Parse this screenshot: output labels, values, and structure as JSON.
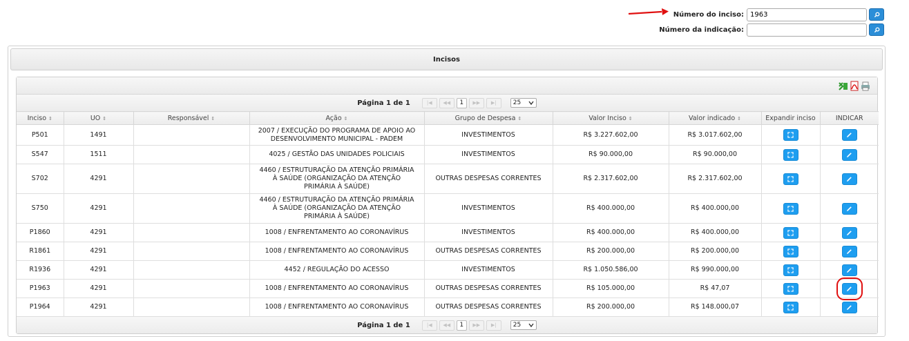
{
  "search": {
    "inciso_label": "Número do inciso:",
    "inciso_value": "1963",
    "indicacao_label": "Número da indicação:",
    "indicacao_value": ""
  },
  "panel": {
    "title": "Incisos"
  },
  "pagination": {
    "info": "Página 1 de 1",
    "current_page": "1",
    "rows_per_page": "25"
  },
  "table": {
    "headers": [
      "Inciso",
      "UO",
      "Responsável",
      "Ação",
      "Grupo de Despesa",
      "Valor Inciso",
      "Valor indicado",
      "Expandir inciso",
      "INDICAR"
    ],
    "rows": [
      {
        "inciso": "P501",
        "uo": "1491",
        "responsavel": "",
        "acao": "2007 / EXECUÇÃO DO PROGRAMA DE APOIO AO DESENVOLVIMENTO MUNICIPAL - PADEM",
        "grupo": "INVESTIMENTOS",
        "valor_inciso": "R$ 3.227.602,00",
        "valor_indicado": "R$ 3.017.602,00"
      },
      {
        "inciso": "S547",
        "uo": "1511",
        "responsavel": "",
        "acao": "4025 / GESTÃO DAS UNIDADES POLICIAIS",
        "grupo": "INVESTIMENTOS",
        "valor_inciso": "R$ 90.000,00",
        "valor_indicado": "R$ 90.000,00"
      },
      {
        "inciso": "S702",
        "uo": "4291",
        "responsavel": "",
        "acao": "4460 / ESTRUTURAÇÃO DA ATENÇÃO PRIMÁRIA À SAÚDE (ORGANIZAÇÃO DA ATENÇÃO PRIMÁRIA À SAÚDE)",
        "grupo": "OUTRAS DESPESAS CORRENTES",
        "valor_inciso": "R$ 2.317.602,00",
        "valor_indicado": "R$ 2.317.602,00"
      },
      {
        "inciso": "S750",
        "uo": "4291",
        "responsavel": "",
        "acao": "4460 / ESTRUTURAÇÃO DA ATENÇÃO PRIMÁRIA À SAÚDE (ORGANIZAÇÃO DA ATENÇÃO PRIMÁRIA À SAÚDE)",
        "grupo": "INVESTIMENTOS",
        "valor_inciso": "R$ 400.000,00",
        "valor_indicado": "R$ 400.000,00"
      },
      {
        "inciso": "P1860",
        "uo": "4291",
        "responsavel": "",
        "acao": "1008 / ENFRENTAMENTO AO CORONAVÍRUS",
        "grupo": "INVESTIMENTOS",
        "valor_inciso": "R$ 400.000,00",
        "valor_indicado": "R$ 400.000,00"
      },
      {
        "inciso": "R1861",
        "uo": "4291",
        "responsavel": "",
        "acao": "1008 / ENFRENTAMENTO AO CORONAVÍRUS",
        "grupo": "OUTRAS DESPESAS CORRENTES",
        "valor_inciso": "R$ 200.000,00",
        "valor_indicado": "R$ 200.000,00"
      },
      {
        "inciso": "R1936",
        "uo": "4291",
        "responsavel": "",
        "acao": "4452 / REGULAÇÃO DO ACESSO",
        "grupo": "INVESTIMENTOS",
        "valor_inciso": "R$ 1.050.586,00",
        "valor_indicado": "R$ 990.000,00"
      },
      {
        "inciso": "P1963",
        "uo": "4291",
        "responsavel": "",
        "acao": "1008 / ENFRENTAMENTO AO CORONAVÍRUS",
        "grupo": "OUTRAS DESPESAS CORRENTES",
        "valor_inciso": "R$ 105.000,00",
        "valor_indicado": "R$ 47,07"
      },
      {
        "inciso": "P1964",
        "uo": "4291",
        "responsavel": "",
        "acao": "1008 / ENFRENTAMENTO AO CORONAVÍRUS",
        "grupo": "OUTRAS DESPESAS CORRENTES",
        "valor_inciso": "R$ 200.000,00",
        "valor_indicado": "R$ 148.000,07"
      }
    ]
  },
  "icons": {
    "search": "search-icon",
    "expand": "expand-icon",
    "indicar": "pencil-icon",
    "export_xls": "excel-icon",
    "export_pdf": "pdf-icon",
    "print": "print-icon"
  },
  "colors": {
    "accent": "#1e9ef0",
    "arrow": "#e01010",
    "highlight": "#e01010"
  }
}
